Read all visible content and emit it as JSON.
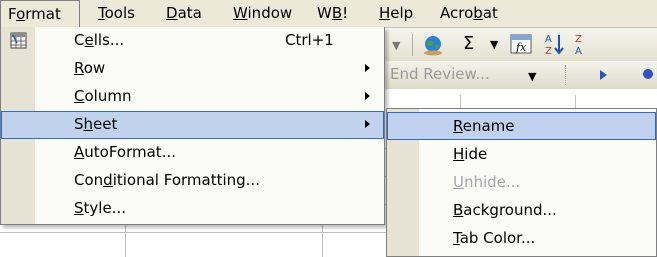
{
  "menubar": {
    "items": [
      {
        "label": "Format",
        "underline_index": 1,
        "active": true
      },
      {
        "label": "Tools",
        "underline_index": 0
      },
      {
        "label": "Data",
        "underline_index": 0
      },
      {
        "label": "Window",
        "underline_index": 0
      },
      {
        "label": "WB!",
        "underline_index": 1
      },
      {
        "label": "Help",
        "underline_index": 0
      },
      {
        "label": "Acrobat",
        "underline_index": 4
      }
    ]
  },
  "toolbar": {
    "review_label": "End Review...",
    "sum_symbol": "Σ",
    "sort_symbol": "A↓Z"
  },
  "format_menu": {
    "items": [
      {
        "label": "Cells...",
        "underline_index": 1,
        "shortcut": "Ctrl+1",
        "submenu": false,
        "icon": "format-cells-icon"
      },
      {
        "label": "Row",
        "underline_index": 0,
        "submenu": true
      },
      {
        "label": "Column",
        "underline_index": 0,
        "submenu": true
      },
      {
        "label": "Sheet",
        "underline_index": 1,
        "submenu": true,
        "highlighted": true
      },
      {
        "label": "AutoFormat...",
        "underline_index": 0,
        "submenu": false
      },
      {
        "label": "Conditional Formatting...",
        "underline_index": 3,
        "submenu": false
      },
      {
        "label": "Style...",
        "underline_index": 0,
        "submenu": false
      }
    ]
  },
  "sheet_submenu": {
    "items": [
      {
        "label": "Rename",
        "underline_index": 0,
        "highlighted": true
      },
      {
        "label": "Hide",
        "underline_index": 0
      },
      {
        "label": "Unhide...",
        "underline_index": 0,
        "disabled": true
      },
      {
        "label": "Background...",
        "underline_index": 0
      },
      {
        "label": "Tab Color...",
        "underline_index": 0
      }
    ]
  },
  "colors": {
    "menu_bg": "#ece9d8",
    "highlight_bg": "#c1d2ee",
    "highlight_border": "#316ac5",
    "disabled_text": "#a7a6aa"
  }
}
